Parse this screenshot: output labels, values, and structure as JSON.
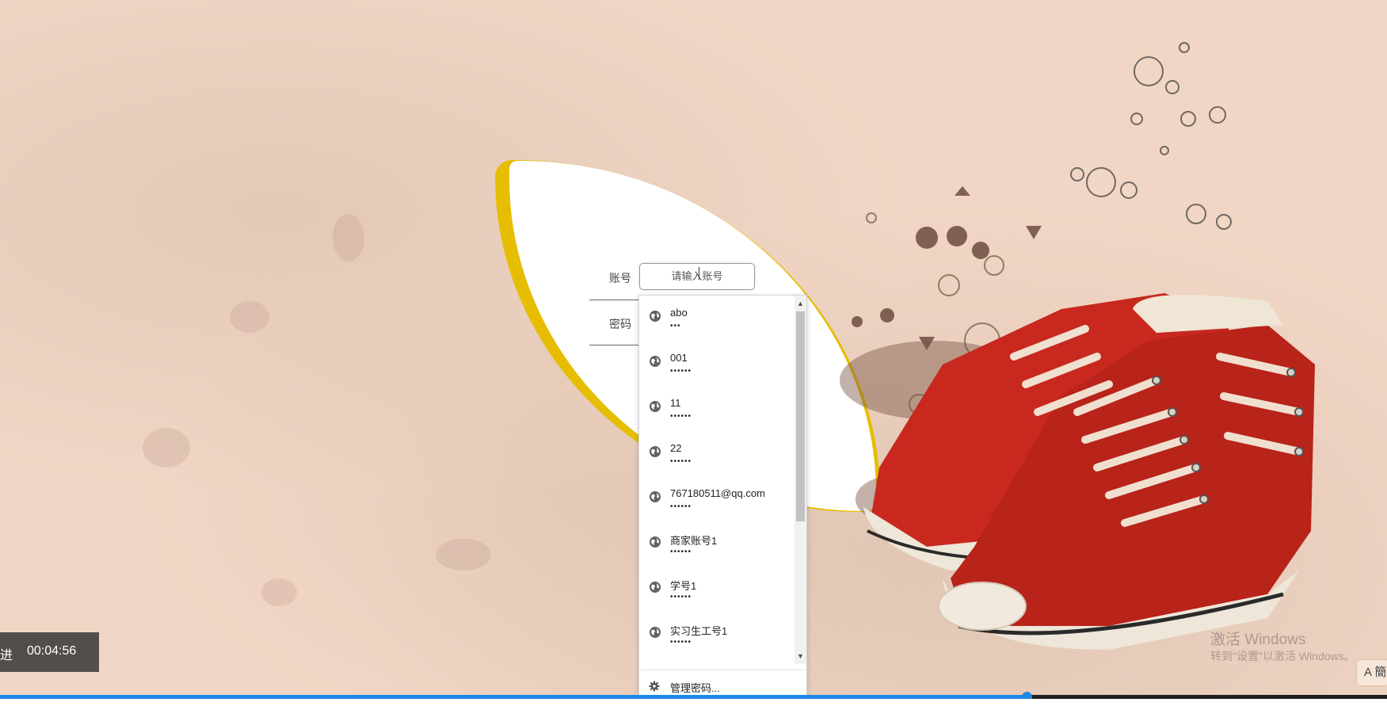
{
  "form": {
    "account_label": "账号",
    "password_label": "密码",
    "account_placeholder": "请输入账号"
  },
  "autocomplete": {
    "items": [
      {
        "user": "abo",
        "pass": "•••"
      },
      {
        "user": "001",
        "pass": "••••••"
      },
      {
        "user": "11",
        "pass": "••••••"
      },
      {
        "user": "22",
        "pass": "••••••"
      },
      {
        "user": "767180511@qq.com",
        "pass": "••••••"
      },
      {
        "user": "商家账号1",
        "pass": "••••••"
      },
      {
        "user": "学号1",
        "pass": "••••••"
      },
      {
        "user": "实习生工号1",
        "pass": "••••••"
      }
    ],
    "manage_label": "管理密码...",
    "scroll_up": "▲",
    "scroll_down": "▼"
  },
  "video": {
    "left_text": "进",
    "time": "00:04:56",
    "progress_fraction": 0.74,
    "accent_color": "#1e88e5"
  },
  "watermark": {
    "line1": "激活 Windows",
    "line2": "转到\"设置\"以激活 Windows。"
  },
  "ime": {
    "label": "A 簡"
  },
  "colors": {
    "leaf_border": "#e6bd00",
    "shoe": "#c8281e"
  }
}
